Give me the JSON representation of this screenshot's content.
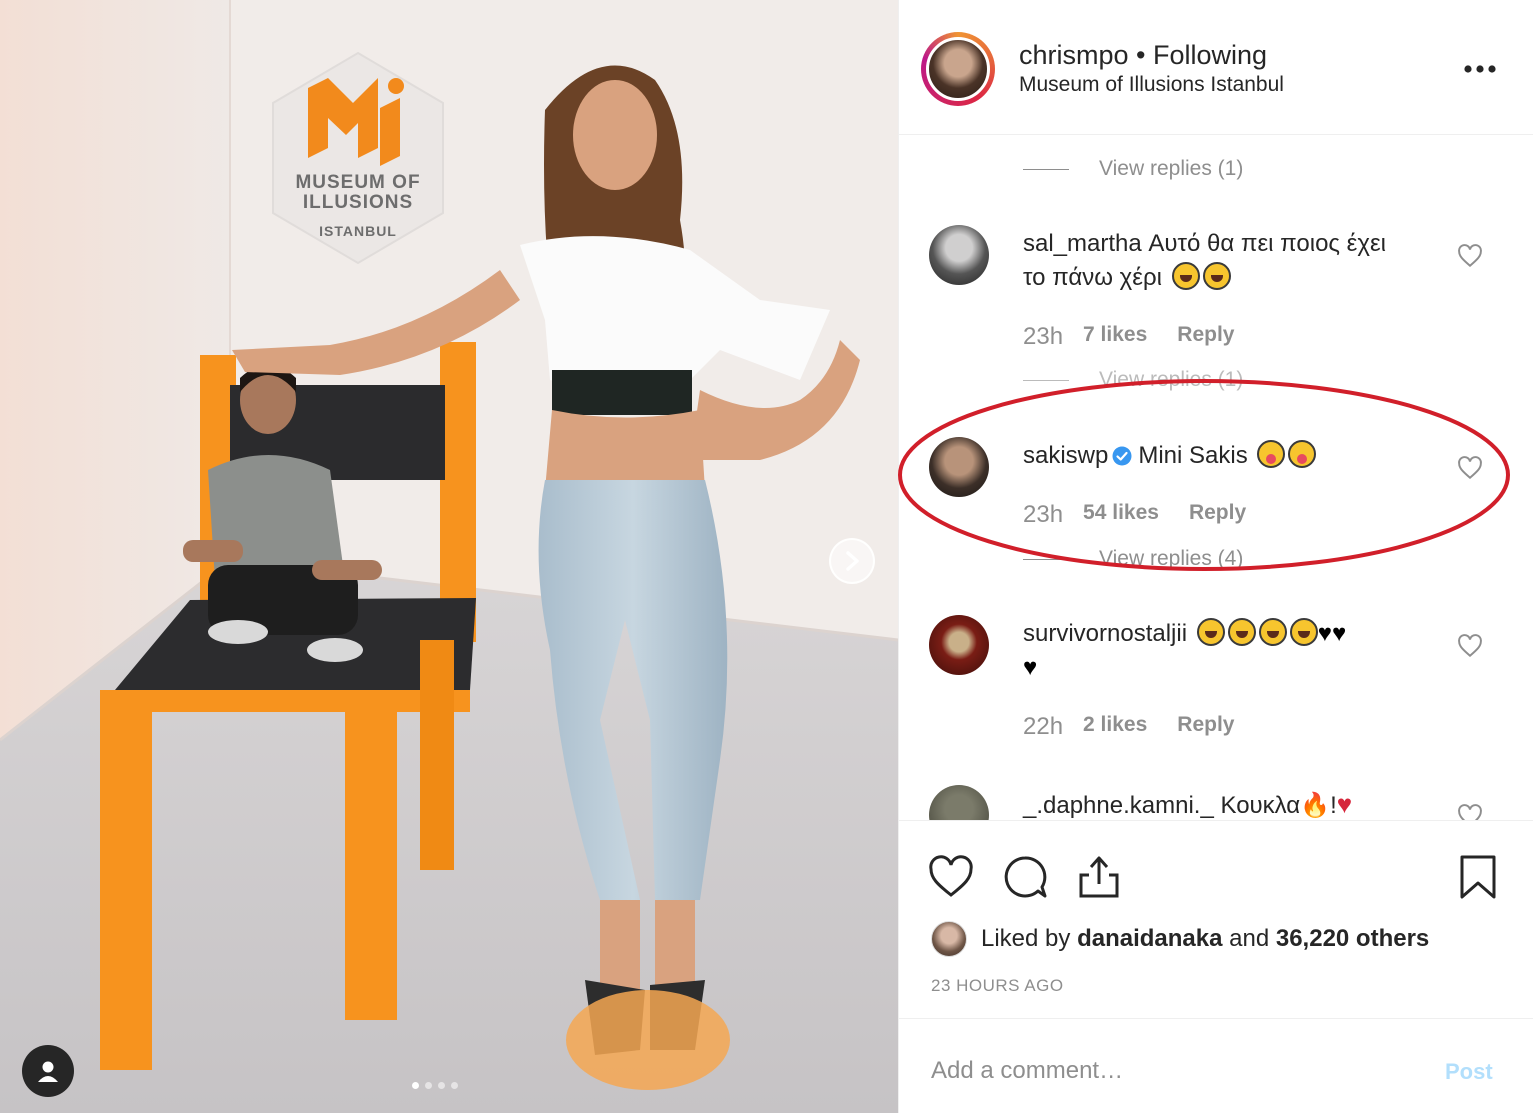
{
  "photo": {
    "logo": {
      "line1": "MUSEUM OF",
      "line2": "ILLUSIONS",
      "line3": "ISTANBUL",
      "mark_color": "#f28a1c"
    },
    "next_icon": "chevron-right-icon",
    "tag_icon": "user-tag-icon",
    "carousel_dots": 4,
    "carousel_active": 1
  },
  "header": {
    "username": "chrismpo",
    "separator": " • ",
    "follow_status": "Following",
    "location": "Museum of Illusions Istanbul",
    "more": "•••"
  },
  "comments": {
    "top_view_replies": "View replies (1)",
    "items": [
      {
        "username": "sal_martha",
        "text_line1": "Αυτό θα πει ποιος έχει",
        "text_line2": "το πάνω χέρι",
        "emoji": [
          "laughing",
          "laughing"
        ],
        "time": "23h",
        "likes": "7 likes",
        "reply": "Reply",
        "view_replies": "View replies (1)"
      },
      {
        "username": "sakiswp",
        "verified": true,
        "text": "Mini Sakis",
        "emoji": [
          "tongue",
          "tongue"
        ],
        "time": "23h",
        "likes": "54 likes",
        "reply": "Reply",
        "view_replies": "View replies (4)",
        "highlighted": true,
        "highlight_color": "#d11f2a"
      },
      {
        "username": "survivornostaljii",
        "emoji": [
          "laughing",
          "laughing",
          "laughing",
          "laughing",
          "black-heart",
          "black-heart",
          "black-heart"
        ],
        "heart_glyph": "♥",
        "time": "22h",
        "likes": "2 likes",
        "reply": "Reply"
      },
      {
        "username": "_.daphne.kamni._",
        "text": "Κουκλα",
        "text_sep": "!",
        "fire_glyph": "🔥",
        "heart_glyph": "♥"
      }
    ]
  },
  "actions": {
    "like_icon": "heart-icon",
    "comment_icon": "comment-icon",
    "share_icon": "share-icon",
    "save_icon": "bookmark-icon",
    "liked_by_prefix": "Liked by ",
    "liked_by_user": "danaidanaka",
    "liked_by_mid": " and ",
    "liked_by_others": "36,220 others",
    "timestamp": "23 HOURS AGO"
  },
  "add_comment": {
    "placeholder": "Add a comment…",
    "post_label": "Post"
  },
  "colors": {
    "text": "#262626",
    "muted": "#8e8e8e",
    "verified": "#3897f0",
    "post_disabled": "#b2dffc",
    "chair_orange": "#f7931e"
  }
}
